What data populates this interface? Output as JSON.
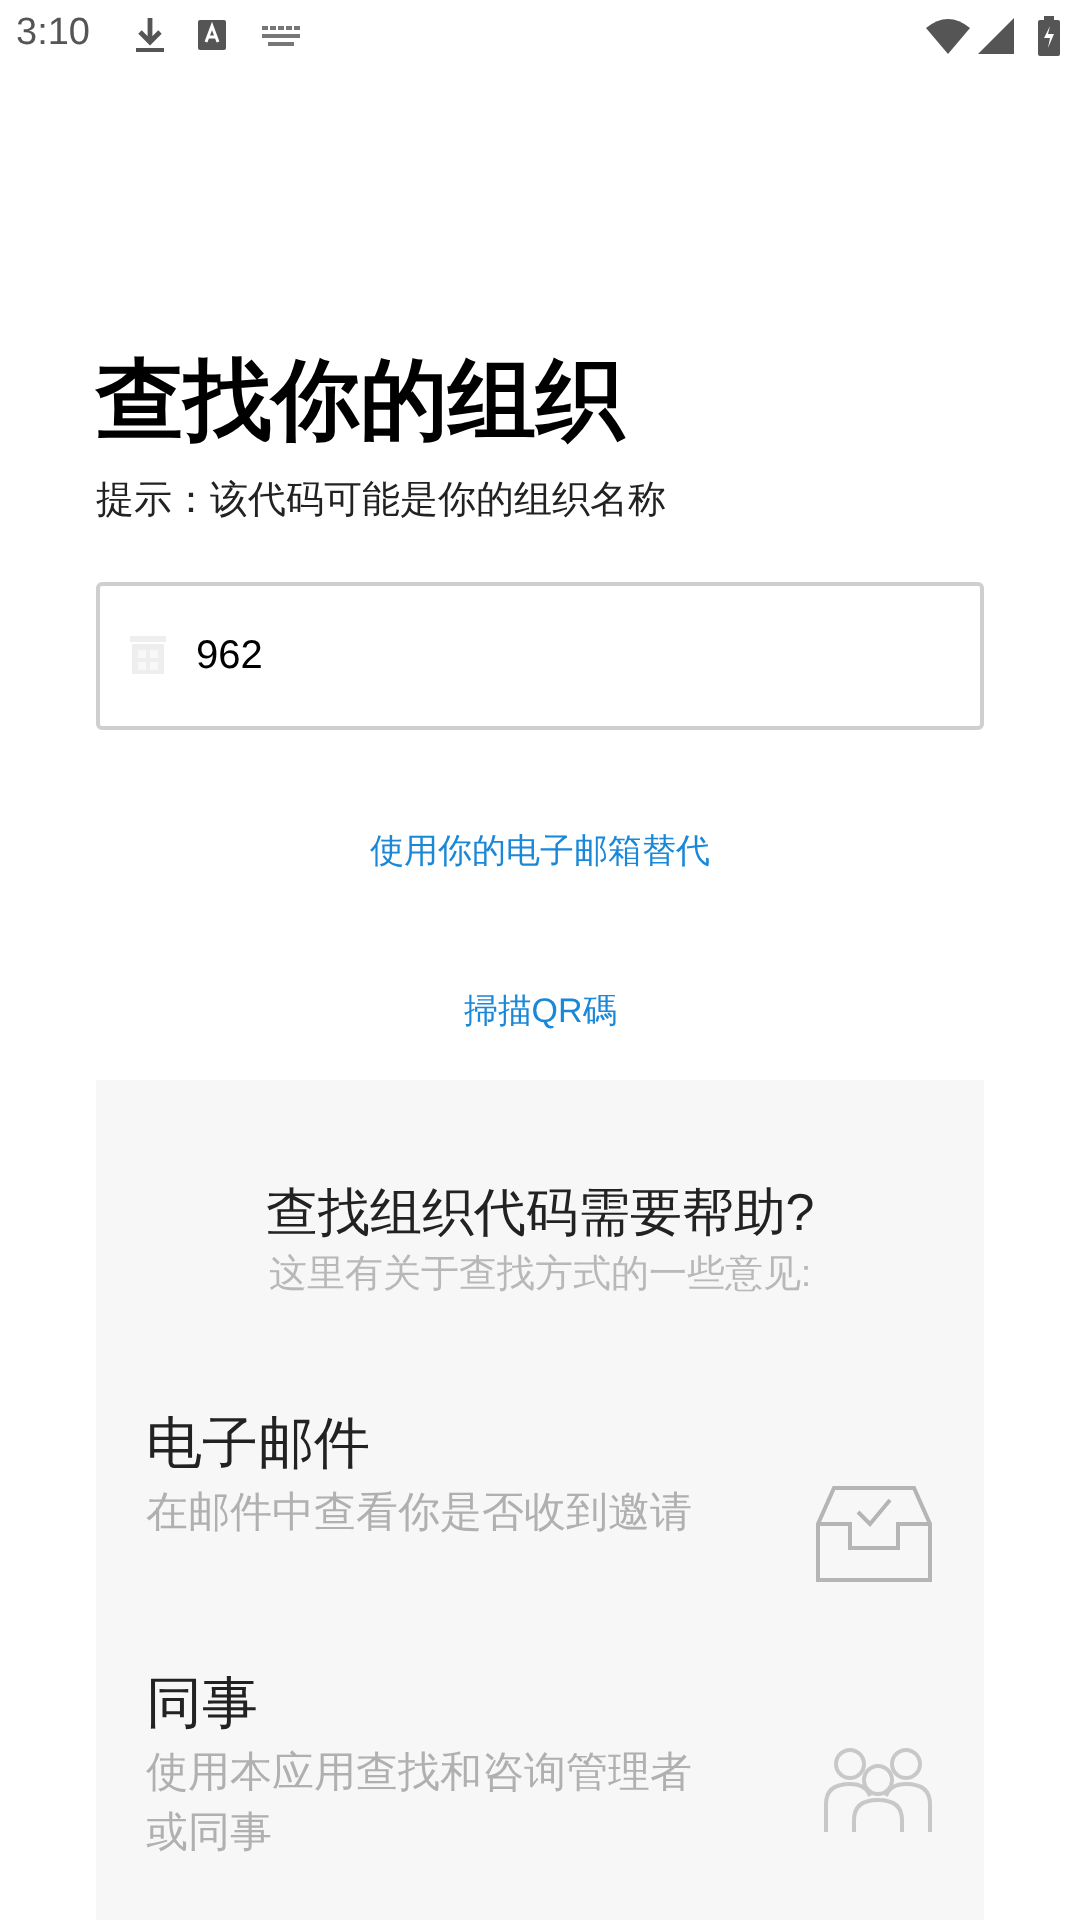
{
  "status_bar": {
    "time": "3:10"
  },
  "title": "查找你的组织",
  "hint": "提示：该代码可能是你的组织名称",
  "org_field": {
    "value": "962"
  },
  "links": [
    "使用你的电子邮箱替代",
    "掃描QR碼"
  ],
  "help": {
    "title": "查找组织代码需要帮助?",
    "subtitle": "这里有关于查找方式的一些意见:",
    "options": [
      {
        "kind": "email",
        "title": "电子邮件",
        "description": "在邮件中查看你是否收到邀请"
      },
      {
        "kind": "coworkers",
        "title": "同事",
        "description": "使用本应用查找和咨询管理者或同事"
      }
    ]
  }
}
